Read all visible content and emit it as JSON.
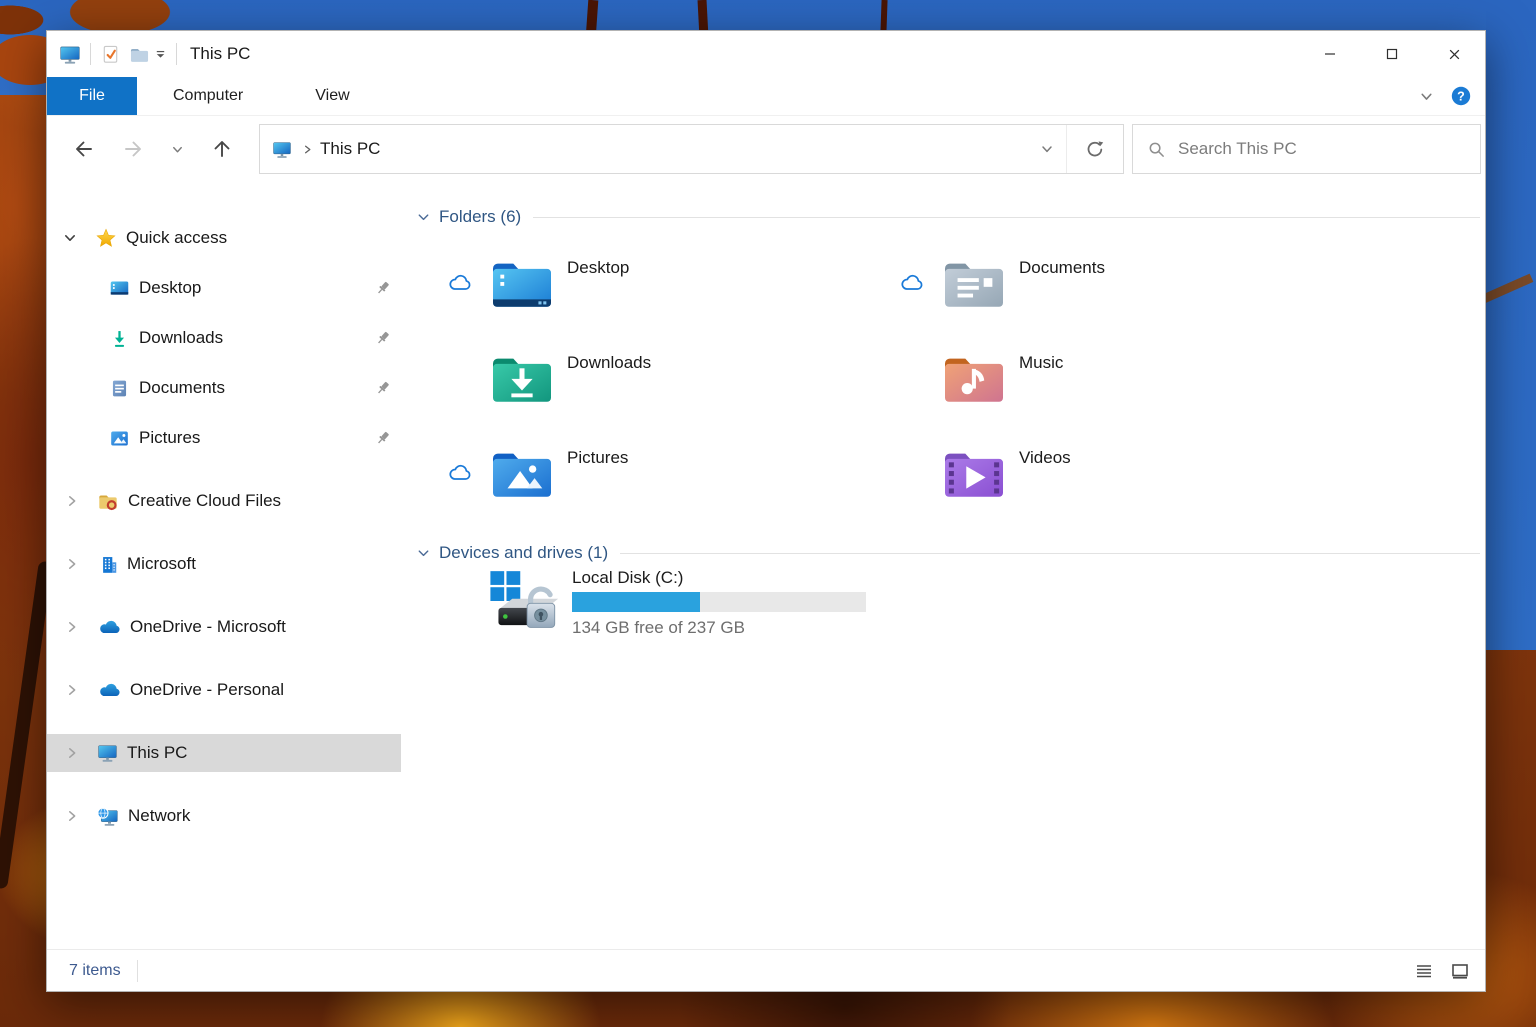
{
  "window": {
    "title": "This PC"
  },
  "ribbon": {
    "tabs": [
      {
        "label": "File",
        "active": true
      },
      {
        "label": "Computer",
        "active": false
      },
      {
        "label": "View",
        "active": false
      }
    ]
  },
  "address": {
    "location": "This PC",
    "search_placeholder": "Search This PC"
  },
  "sidebar": {
    "quick_access": {
      "label": "Quick access",
      "expanded": true,
      "children": [
        {
          "label": "Desktop",
          "pinned": true
        },
        {
          "label": "Downloads",
          "pinned": true
        },
        {
          "label": "Documents",
          "pinned": true
        },
        {
          "label": "Pictures",
          "pinned": true
        }
      ]
    },
    "roots": [
      {
        "label": "Creative Cloud Files",
        "expanded": false,
        "selected": false
      },
      {
        "label": "Microsoft",
        "expanded": false,
        "selected": false
      },
      {
        "label": "OneDrive - Microsoft",
        "expanded": false,
        "selected": false
      },
      {
        "label": "OneDrive - Personal",
        "expanded": false,
        "selected": false
      },
      {
        "label": "This PC",
        "expanded": false,
        "selected": true
      },
      {
        "label": "Network",
        "expanded": false,
        "selected": false
      }
    ]
  },
  "main": {
    "folders_header": "Folders (6)",
    "folders": [
      {
        "name": "Desktop",
        "cloud_status": true
      },
      {
        "name": "Documents",
        "cloud_status": true
      },
      {
        "name": "Downloads",
        "cloud_status": false
      },
      {
        "name": "Music",
        "cloud_status": false
      },
      {
        "name": "Pictures",
        "cloud_status": true
      },
      {
        "name": "Videos",
        "cloud_status": false
      }
    ],
    "devices_header": "Devices and drives (1)",
    "drive": {
      "name": "Local Disk (C:)",
      "free_text": "134 GB free of 237 GB",
      "used_percent": 43.5
    }
  },
  "statusbar": {
    "items_count": "7 items"
  },
  "colors": {
    "accent_blue": "#1072c6",
    "selection_gray": "#d9d9d9",
    "group_header_blue": "#2f5683",
    "drive_bar_fill": "#2aa2de",
    "drive_bar_track": "#e8e8e8",
    "cloud_icon_blue": "#1a7ad8",
    "status_count_blue": "#3d5a8f",
    "folder_desktop_blue": "#1b7cd4",
    "folder_documents_gray": "#96a7b5",
    "folder_downloads_teal": "#12967e",
    "folder_music_orange": "#e09a74",
    "folder_pictures_blue": "#1b6fd0",
    "folder_videos_purple": "#8a4fd2"
  }
}
